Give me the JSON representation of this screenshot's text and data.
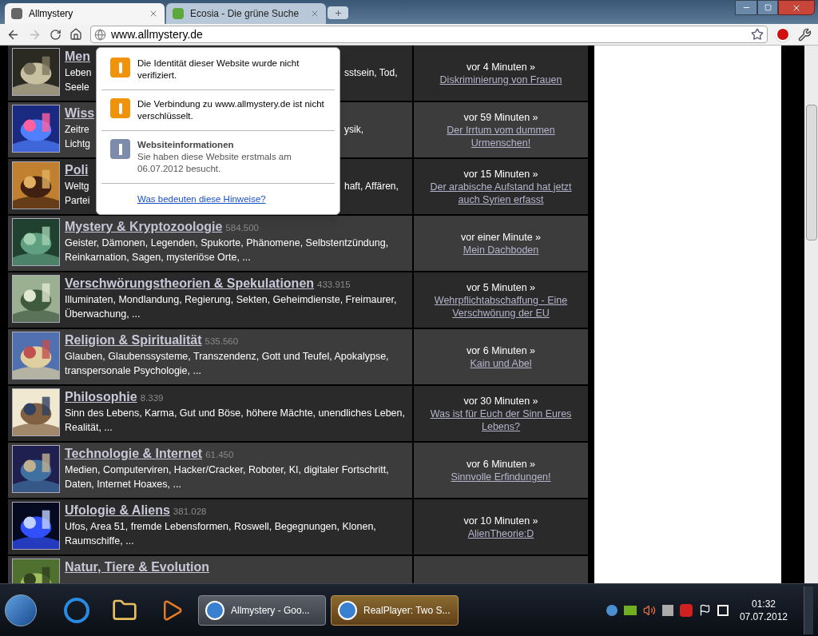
{
  "tabs": [
    {
      "label": "Allmystery",
      "selected": true
    },
    {
      "label": "Ecosia - Die grüne Suche",
      "selected": false
    }
  ],
  "toolbar": {
    "url": "www.allmystery.de",
    "back_disabled": false,
    "forward_disabled": true
  },
  "popup": {
    "items": [
      {
        "kind": "warning",
        "text": "Die Identität dieser Website wurde nicht verifiziert."
      },
      {
        "kind": "warning",
        "text": "Die Verbindung zu www.allmystery.de ist nicht verschlüsselt."
      },
      {
        "kind": "info",
        "title": "Websiteinformationen",
        "text": "Sie haben diese Website erstmals am 06.07.2012 besucht."
      }
    ],
    "link": "Was bedeuten diese Hinweise?"
  },
  "forums": [
    {
      "kind": "covered",
      "title": "Men",
      "lines": [
        {
          "left": "Leben",
          "right": "sstsein, Tod,"
        },
        {
          "left": "Seele"
        }
      ],
      "time": "vor 4 Minuten »",
      "link": "Diskriminierung von Frauen"
    },
    {
      "kind": "covered",
      "title": "Wiss",
      "lines": [
        {
          "left": "Zeitre",
          "right": "ysik,"
        },
        {
          "left": "Lichtg"
        }
      ],
      "time": "vor 59 Minuten »",
      "link": "Der Irrtum vom dummen Urmenschen!"
    },
    {
      "kind": "covered",
      "title": "Poli",
      "lines": [
        {
          "left": "Weltg",
          "right": "haft, Affären,"
        },
        {
          "left": "Partei"
        }
      ],
      "time": "vor 15 Minuten »",
      "link": "Der arabische Aufstand hat jetzt auch Syrien erfasst"
    },
    {
      "kind": "full",
      "title": "Mystery & Kryptozoologie",
      "count": "584.500",
      "description": "Geister, Dämonen, Legenden, Spukorte, Phänomene, Selbstentzündung, Reinkarnation, Sagen, mysteriöse Orte, ...",
      "time": "vor einer Minute »",
      "link": "Mein Dachboden"
    },
    {
      "kind": "full",
      "title": "Verschwörungstheorien & Spekulationen",
      "count": "433.915",
      "description": "Illuminaten, Mondlandung, Regierung, Sekten, Geheimdienste, Freimaurer, Überwachung, ...",
      "time": "vor 5 Minuten »",
      "link": "Wehrpflichtabschaffung - Eine Verschwörung der EU"
    },
    {
      "kind": "full",
      "title": "Religion & Spiritualität",
      "count": "535.560",
      "description": "Glauben, Glaubenssysteme, Transzendenz, Gott und Teufel, Apokalypse, transpersonale Psychologie, ...",
      "time": "vor 6 Minuten »",
      "link": "Kain und Abel"
    },
    {
      "kind": "full",
      "title": "Philosophie",
      "count": "8.339",
      "description": "Sinn des Lebens, Karma, Gut und Böse, höhere Mächte, unendliches Leben, Realität, ...",
      "time": "vor 30 Minuten »",
      "link": "Was ist für Euch der Sinn Eures Lebens?"
    },
    {
      "kind": "full",
      "title": "Technologie & Internet",
      "count": "61.450",
      "description": "Medien, Computerviren, Hacker/Cracker, Roboter, KI, digitaler Fortschritt, Daten, Internet Hoaxes, ...",
      "time": "vor 6 Minuten »",
      "link": "Sinnvolle Erfindungen!"
    },
    {
      "kind": "full",
      "title": "Ufologie & Aliens",
      "count": "381.028",
      "description": "Ufos, Area 51, fremde Lebensformen, Roswell, Begegnungen, Klonen, Raumschiffe, ...",
      "time": "vor 10 Minuten »",
      "link": "AlienTheorie:D"
    },
    {
      "kind": "cut",
      "title": "Natur, Tiere & Evolution"
    }
  ],
  "taskbar": {
    "windows": [
      {
        "label": "Allmystery - Goo...",
        "selected": false
      },
      {
        "label": "RealPlayer: Two S...",
        "selected": true
      }
    ],
    "time": "01:32",
    "date": "07.07.2012"
  }
}
